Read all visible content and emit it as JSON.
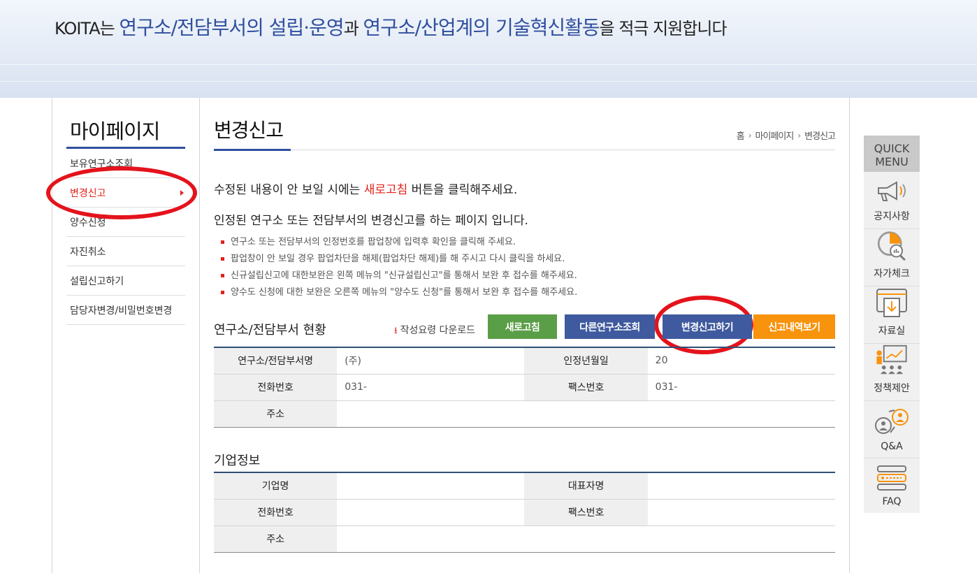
{
  "banner": {
    "part1": "KOITA는 ",
    "part2": "연구소/전담부서의 설립·운영",
    "part3": "과 ",
    "part4": "연구소/산업계의 기술혁신활동",
    "part5": "을 적극 지원합니다"
  },
  "sidebar": {
    "title": "마이페이지",
    "items": [
      {
        "label": "보유연구소조회"
      },
      {
        "label": "변경신고"
      },
      {
        "label": "양수신청"
      },
      {
        "label": "자진취소"
      },
      {
        "label": "설립신고하기"
      },
      {
        "label": "담당자변경/비밀번호변경"
      }
    ],
    "active_index": 1
  },
  "main": {
    "title": "변경신고",
    "breadcrumb": [
      "홈",
      "마이페이지",
      "변경신고"
    ],
    "notice1_before": "수정된 내용이 안 보일 시에는 ",
    "notice1_highlight": "새로고침",
    "notice1_after": " 버튼을 클릭해주세요.",
    "notice2": "인정된 연구소 또는 전담부서의 변경신고를 하는 페이지 입니다.",
    "bullets": [
      "연구소 또는 전담부서의 인정번호를 팝업창에 입력후 확인을 클릭해 주세요.",
      "팝업창이 안 보일 경우 팝업차단을 해제(팝업차단 해제)를 해 주시고 다시 클릭을 하세요.",
      "신규설립신고에 대한보완은 왼쪽 메뉴의 \"신규설립신고\"를 통해서 보완 후 접수를 해주세요.",
      "양수도 신청에 대한 보완은 오른쪽 메뉴의 \"양수도 신청\"를 통해서 보완 후 접수를 해주세요."
    ],
    "lab_section": {
      "title": "연구소/전담부서 현황",
      "download_label": "작성요령 다운로드",
      "buttons": {
        "refresh": "새로고침",
        "other_lab": "다른연구소조회",
        "change_report": "변경신고하기",
        "history": "신고내역보기"
      },
      "rows": [
        {
          "h1": "연구소/전담부서명",
          "v1": "(주)",
          "h2": "인정년월일",
          "v2": "20"
        },
        {
          "h1": "전화번호",
          "v1": "031-",
          "h2": "팩스번호",
          "v2": "031-"
        },
        {
          "h1": "주소",
          "v1": ""
        }
      ]
    },
    "company_section": {
      "title": "기업정보",
      "rows": [
        {
          "h1": "기업명",
          "v1": "",
          "h2": "대표자명",
          "v2": ""
        },
        {
          "h1": "전화번호",
          "v1": "",
          "h2": "팩스번호",
          "v2": ""
        },
        {
          "h1": "주소",
          "v1": ""
        }
      ]
    }
  },
  "quick_menu": {
    "title_line1": "QUICK",
    "title_line2": "MENU",
    "items": [
      {
        "label": "공지사항",
        "icon": "megaphone-icon"
      },
      {
        "label": "자가체크",
        "icon": "chart-magnifier-icon"
      },
      {
        "label": "자료실",
        "icon": "archive-download-icon"
      },
      {
        "label": "정책제안",
        "icon": "presentation-icon"
      },
      {
        "label": "Q&A",
        "icon": "qa-people-icon"
      },
      {
        "label": "FAQ",
        "icon": "faq-icon"
      }
    ]
  },
  "colors": {
    "brand_blue": "#2f4f9e",
    "highlight_red": "#e0231c",
    "btn_green": "#5a9e47",
    "btn_navy": "#3f5a9e",
    "btn_orange": "#f7930d"
  }
}
